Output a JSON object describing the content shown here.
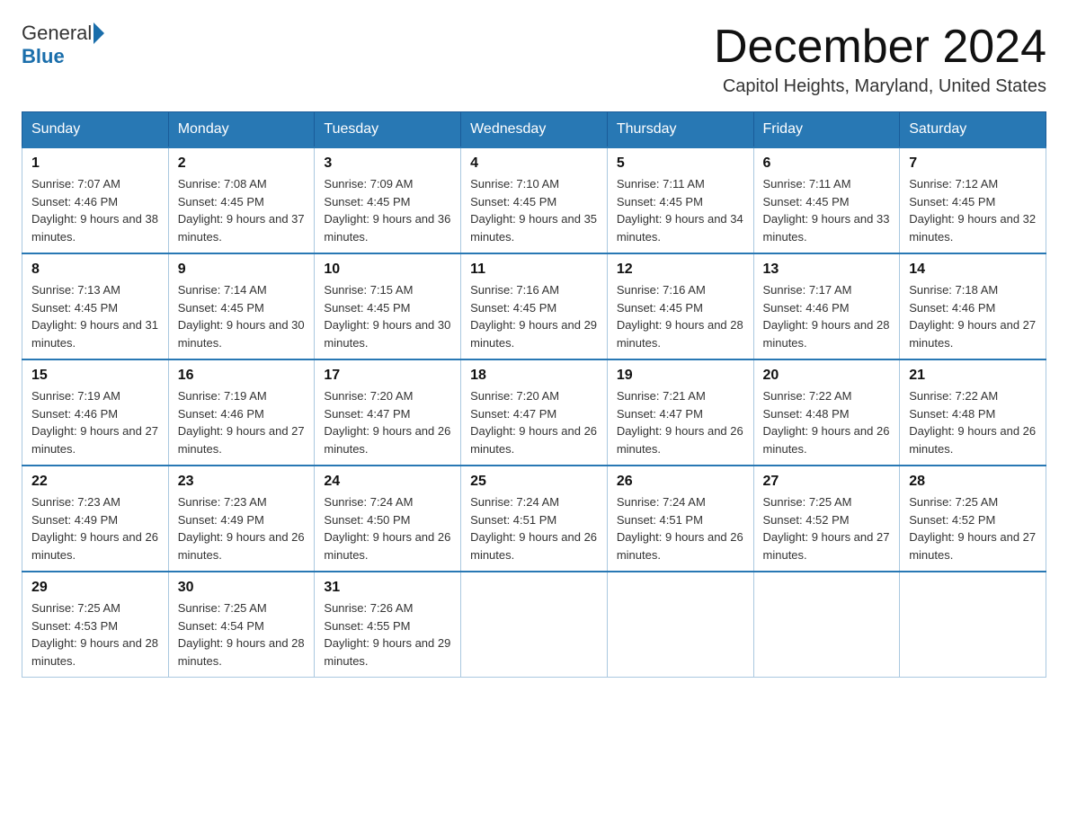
{
  "logo": {
    "general": "General",
    "blue": "Blue"
  },
  "title": "December 2024",
  "location": "Capitol Heights, Maryland, United States",
  "headers": [
    "Sunday",
    "Monday",
    "Tuesday",
    "Wednesday",
    "Thursday",
    "Friday",
    "Saturday"
  ],
  "weeks": [
    [
      {
        "day": "1",
        "sunrise": "7:07 AM",
        "sunset": "4:46 PM",
        "daylight": "9 hours and 38 minutes."
      },
      {
        "day": "2",
        "sunrise": "7:08 AM",
        "sunset": "4:45 PM",
        "daylight": "9 hours and 37 minutes."
      },
      {
        "day": "3",
        "sunrise": "7:09 AM",
        "sunset": "4:45 PM",
        "daylight": "9 hours and 36 minutes."
      },
      {
        "day": "4",
        "sunrise": "7:10 AM",
        "sunset": "4:45 PM",
        "daylight": "9 hours and 35 minutes."
      },
      {
        "day": "5",
        "sunrise": "7:11 AM",
        "sunset": "4:45 PM",
        "daylight": "9 hours and 34 minutes."
      },
      {
        "day": "6",
        "sunrise": "7:11 AM",
        "sunset": "4:45 PM",
        "daylight": "9 hours and 33 minutes."
      },
      {
        "day": "7",
        "sunrise": "7:12 AM",
        "sunset": "4:45 PM",
        "daylight": "9 hours and 32 minutes."
      }
    ],
    [
      {
        "day": "8",
        "sunrise": "7:13 AM",
        "sunset": "4:45 PM",
        "daylight": "9 hours and 31 minutes."
      },
      {
        "day": "9",
        "sunrise": "7:14 AM",
        "sunset": "4:45 PM",
        "daylight": "9 hours and 30 minutes."
      },
      {
        "day": "10",
        "sunrise": "7:15 AM",
        "sunset": "4:45 PM",
        "daylight": "9 hours and 30 minutes."
      },
      {
        "day": "11",
        "sunrise": "7:16 AM",
        "sunset": "4:45 PM",
        "daylight": "9 hours and 29 minutes."
      },
      {
        "day": "12",
        "sunrise": "7:16 AM",
        "sunset": "4:45 PM",
        "daylight": "9 hours and 28 minutes."
      },
      {
        "day": "13",
        "sunrise": "7:17 AM",
        "sunset": "4:46 PM",
        "daylight": "9 hours and 28 minutes."
      },
      {
        "day": "14",
        "sunrise": "7:18 AM",
        "sunset": "4:46 PM",
        "daylight": "9 hours and 27 minutes."
      }
    ],
    [
      {
        "day": "15",
        "sunrise": "7:19 AM",
        "sunset": "4:46 PM",
        "daylight": "9 hours and 27 minutes."
      },
      {
        "day": "16",
        "sunrise": "7:19 AM",
        "sunset": "4:46 PM",
        "daylight": "9 hours and 27 minutes."
      },
      {
        "day": "17",
        "sunrise": "7:20 AM",
        "sunset": "4:47 PM",
        "daylight": "9 hours and 26 minutes."
      },
      {
        "day": "18",
        "sunrise": "7:20 AM",
        "sunset": "4:47 PM",
        "daylight": "9 hours and 26 minutes."
      },
      {
        "day": "19",
        "sunrise": "7:21 AM",
        "sunset": "4:47 PM",
        "daylight": "9 hours and 26 minutes."
      },
      {
        "day": "20",
        "sunrise": "7:22 AM",
        "sunset": "4:48 PM",
        "daylight": "9 hours and 26 minutes."
      },
      {
        "day": "21",
        "sunrise": "7:22 AM",
        "sunset": "4:48 PM",
        "daylight": "9 hours and 26 minutes."
      }
    ],
    [
      {
        "day": "22",
        "sunrise": "7:23 AM",
        "sunset": "4:49 PM",
        "daylight": "9 hours and 26 minutes."
      },
      {
        "day": "23",
        "sunrise": "7:23 AM",
        "sunset": "4:49 PM",
        "daylight": "9 hours and 26 minutes."
      },
      {
        "day": "24",
        "sunrise": "7:24 AM",
        "sunset": "4:50 PM",
        "daylight": "9 hours and 26 minutes."
      },
      {
        "day": "25",
        "sunrise": "7:24 AM",
        "sunset": "4:51 PM",
        "daylight": "9 hours and 26 minutes."
      },
      {
        "day": "26",
        "sunrise": "7:24 AM",
        "sunset": "4:51 PM",
        "daylight": "9 hours and 26 minutes."
      },
      {
        "day": "27",
        "sunrise": "7:25 AM",
        "sunset": "4:52 PM",
        "daylight": "9 hours and 27 minutes."
      },
      {
        "day": "28",
        "sunrise": "7:25 AM",
        "sunset": "4:52 PM",
        "daylight": "9 hours and 27 minutes."
      }
    ],
    [
      {
        "day": "29",
        "sunrise": "7:25 AM",
        "sunset": "4:53 PM",
        "daylight": "9 hours and 28 minutes."
      },
      {
        "day": "30",
        "sunrise": "7:25 AM",
        "sunset": "4:54 PM",
        "daylight": "9 hours and 28 minutes."
      },
      {
        "day": "31",
        "sunrise": "7:26 AM",
        "sunset": "4:55 PM",
        "daylight": "9 hours and 29 minutes."
      },
      null,
      null,
      null,
      null
    ]
  ]
}
